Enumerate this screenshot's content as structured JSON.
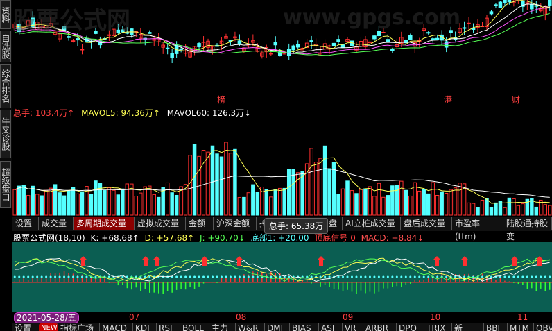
{
  "sidebar": {
    "tabs": [
      {
        "label": "资料"
      },
      {
        "label": "自选股"
      },
      {
        "label": "综合排名"
      },
      {
        "label": "牛叉诊股"
      },
      {
        "label": "超级盘口"
      }
    ]
  },
  "candle": {
    "markers": [
      "榜",
      "港",
      "财"
    ]
  },
  "watermark": {
    "cn": "股票公式网",
    "en": "www.gpgs.com"
  },
  "volume": {
    "legend": {
      "total": "总手: 103.4万↑",
      "mavol5": "MAVOL5: 94.36万↑",
      "mavol60": "MAVOL60: 126.3万↓"
    },
    "colors": {
      "up": "#ff3030",
      "down": "#54ffff",
      "ma5": "#ffff55",
      "ma60": "#ffffff"
    }
  },
  "tabbar1": {
    "tabs": [
      {
        "label": "设置"
      },
      {
        "label": "成交量"
      },
      {
        "label": "多周期成交量",
        "active": true
      },
      {
        "label": "虚拟成交量"
      },
      {
        "label": "金额"
      },
      {
        "label": "沪深金额"
      },
      {
        "label": "持"
      },
      {
        "label": "盘"
      },
      {
        "label": "AI立桩成交量"
      },
      {
        "label": "盘后成交量"
      },
      {
        "label": "市盈率(ttm)"
      },
      {
        "label": "陆股通持股变"
      }
    ]
  },
  "tooltip": {
    "text": "总手: 65.38万"
  },
  "indicator": {
    "name": "股票公式网(18,10)",
    "k": "K: +68.68↑",
    "d": "D: +57.68↑",
    "j": "J: +90.70↓",
    "base": "底部1: +20.00",
    "mid": "顶底信号 0",
    "macd": "MACD: +8.84↓"
  },
  "date_axis": {
    "current": "2021-05-28/五",
    "months": [
      "07",
      "08",
      "09",
      "10",
      "11"
    ]
  },
  "tabbar2": {
    "tabs": [
      {
        "label": "设置"
      },
      {
        "label": "NEW"
      },
      {
        "label": "指标广场"
      },
      {
        "label": "MACD"
      },
      {
        "label": "KDJ"
      },
      {
        "label": "RSI"
      },
      {
        "label": "BOLL"
      },
      {
        "label": "主力"
      },
      {
        "label": "W&R"
      },
      {
        "label": "DMI"
      },
      {
        "label": "BIAS"
      },
      {
        "label": "ASI"
      },
      {
        "label": "VR"
      },
      {
        "label": "ARBR"
      },
      {
        "label": "DPO"
      },
      {
        "label": "TRIX"
      },
      {
        "label": "新DMA"
      },
      {
        "label": "BBI"
      },
      {
        "label": "MTM"
      },
      {
        "label": "OBV"
      }
    ]
  }
}
